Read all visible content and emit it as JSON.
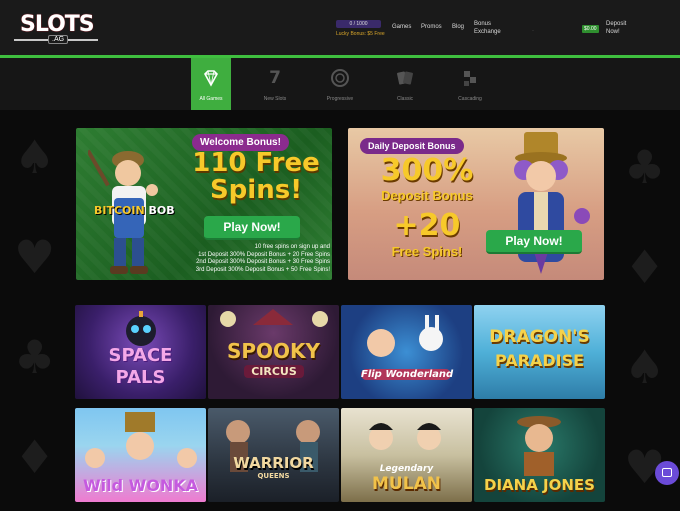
{
  "header": {
    "logo_text": "SLOTS",
    "logo_sub": ".AG",
    "progress_text": "0 / 1000",
    "progress_fraction": 0.0,
    "lucky_bonus": "Lucky Bonus: $5 Free",
    "nav": [
      "Games",
      "Promos",
      "Blog"
    ],
    "bonus_exchange": "Bonus Exchange",
    "balance": "$0.00",
    "deposit": "Deposit Now!"
  },
  "categories": [
    {
      "label": "All Games",
      "icon": "diamond-icon",
      "active": true
    },
    {
      "label": "New Slots",
      "icon": "seven-icon",
      "active": false
    },
    {
      "label": "Progressive",
      "icon": "chip-icon",
      "active": false
    },
    {
      "label": "Classic",
      "icon": "cards-icon",
      "active": false
    },
    {
      "label": "Cascading",
      "icon": "cascade-icon",
      "active": false
    }
  ],
  "banner1": {
    "pill": "Welcome Bonus!",
    "headline_line1": "110 Free",
    "headline_line2": "Spins!",
    "button": "Play Now!",
    "game_logo_1": "BITCOIN",
    "game_logo_2": "BOB",
    "terms": [
      "10 free spins on sign up and",
      "1st Deposit 300% Deposit Bonus + 20 Free Spins",
      "2nd Deposit 300% Deposit Bonus + 30 Free Spins",
      "3rd Deposit 300% Deposit Bonus + 50 Free Spins!"
    ]
  },
  "banner2": {
    "pill": "Daily Deposit Bonus",
    "pct": "300%",
    "deposit_bonus": "Deposit Bonus",
    "plus": "+20",
    "free_spins": "Free Spins!",
    "button": "Play Now!"
  },
  "games": [
    {
      "title_1": "SPACE",
      "title_2": "PALS"
    },
    {
      "title_1": "SPOOKY",
      "title_2": "CIRCUS"
    },
    {
      "title_1": "Flip",
      "title_2": "Wonderland"
    },
    {
      "title_1": "DRAGON'S",
      "title_2": "PARADISE"
    },
    {
      "title_1": "Wild",
      "title_2": "WONKA"
    },
    {
      "title_1": "WARRIOR",
      "title_2": "QUEENS"
    },
    {
      "title_1": "Legendary",
      "title_2": "MULAN"
    },
    {
      "title_1": "DIANA JONES",
      "title_2": ""
    }
  ],
  "colors": {
    "accent_green": "#3fbf3f",
    "button_green": "#2aa84a",
    "gold": "#f7c92a",
    "chat_purple": "#6b4bd8"
  }
}
